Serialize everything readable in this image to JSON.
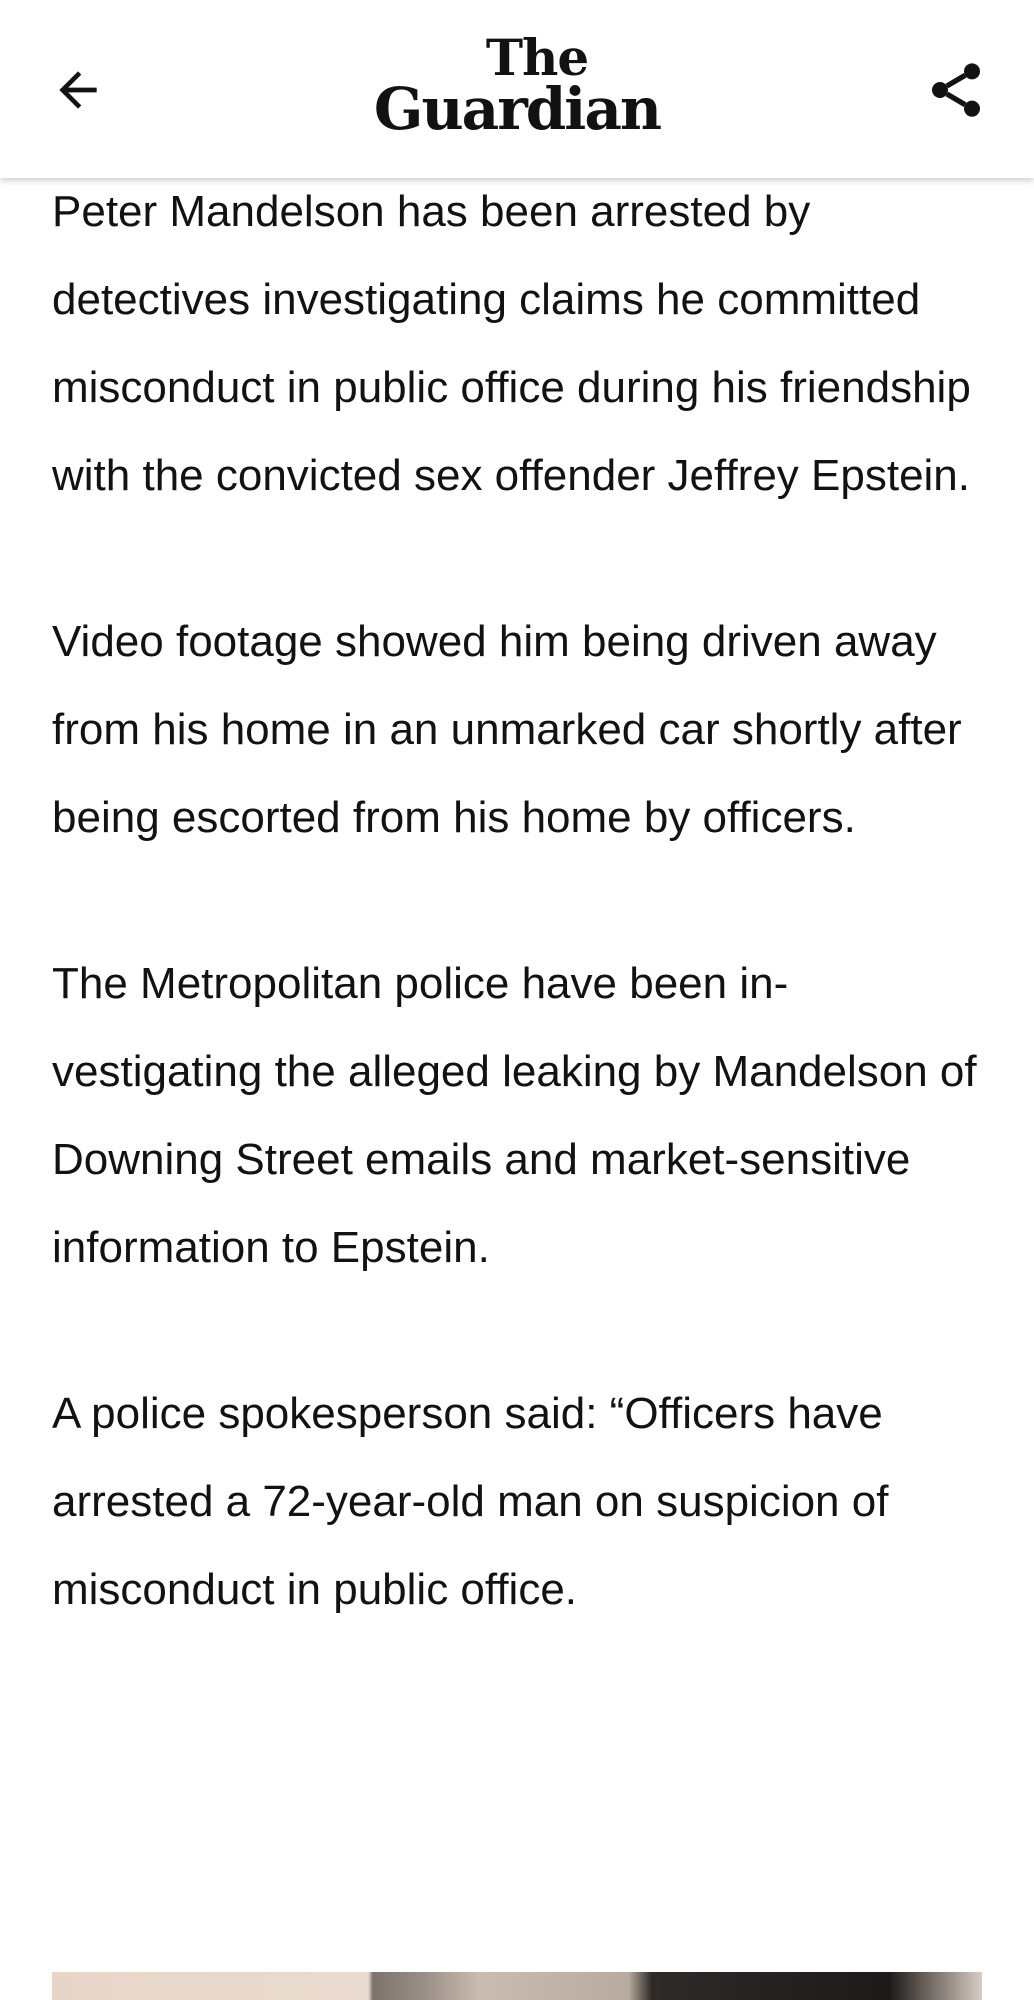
{
  "header": {
    "back_icon": "arrow-left-icon",
    "logo_line1": "The",
    "logo_line2": "Guardian",
    "share_icon": "share-icon"
  },
  "article": {
    "paragraphs": [
      "Peter Mandelson has been arrested by detectives investigating claims he com­mitted misconduct in public office dur­ing his friendship with the convicted sex offender Jeffrey Epstein.",
      "Video footage showed him being driven away from his home in an unmarked car shortly after being escorted from his home by officers.",
      "The Metropolitan police have been in­vestigating the alleged leaking by Mandelson of Downing Street emails and market-sensitive information to Epstein.",
      "A police spokesperson said: “Officers have arrested a 72-year-old man on sus­picion of misconduct in public office."
    ]
  },
  "colors": {
    "text": "#121212",
    "background": "#ffffff"
  }
}
